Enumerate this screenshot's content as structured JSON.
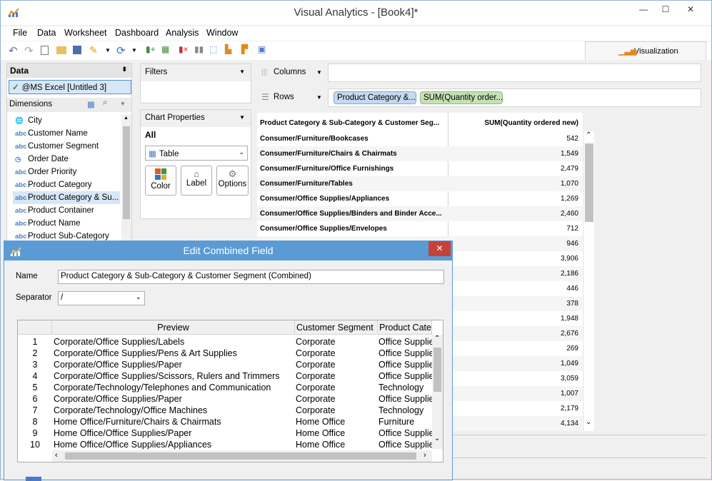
{
  "window": {
    "title": "Visual Analytics - [Book4]*",
    "min": "—",
    "max": "☐",
    "close": "✕"
  },
  "menu": [
    "File",
    "Data",
    "Worksheet",
    "Dashboard",
    "Analysis",
    "Window"
  ],
  "toolbar": {
    "viz_label": "Visualization"
  },
  "data_pane": {
    "header": "Data",
    "source": "@MS Excel [Untitled 3]",
    "dimensions_header": "Dimensions",
    "dimensions": [
      {
        "icon": "globe-icon",
        "type": "🌐",
        "label": "City"
      },
      {
        "icon": "abc-icon",
        "type": "abc",
        "label": "Customer Name"
      },
      {
        "icon": "abc-icon",
        "type": "abc",
        "label": "Customer Segment"
      },
      {
        "icon": "date-icon",
        "type": "◷",
        "label": "Order Date"
      },
      {
        "icon": "abc-icon",
        "type": "abc",
        "label": "Order Priority"
      },
      {
        "icon": "abc-icon",
        "type": "abc",
        "label": "Product Category"
      },
      {
        "icon": "abc-icon",
        "type": "abc",
        "label": "Product Category & Su..."
      },
      {
        "icon": "abc-icon",
        "type": "abc",
        "label": "Product Container"
      },
      {
        "icon": "abc-icon",
        "type": "abc",
        "label": "Product Name"
      },
      {
        "icon": "abc-icon",
        "type": "abc",
        "label": "Product Sub-Category"
      }
    ]
  },
  "filters": {
    "label": "Filters"
  },
  "chart_properties": {
    "label": "Chart Properties",
    "scope": "All",
    "chart_type": "Table",
    "buttons": [
      "Color",
      "Label",
      "Options"
    ]
  },
  "shelves": {
    "columns_label": "Columns",
    "rows_label": "Rows",
    "rows_pills": [
      "Product Category &...",
      "SUM(Quantity order..."
    ]
  },
  "table": {
    "col1_header": "Product Category & Sub-Category & Customer Seg...",
    "col2_header": "SUM(Quantity ordered new)",
    "rows": [
      {
        "name": "Consumer/Furniture/Bookcases",
        "value": "542"
      },
      {
        "name": "Consumer/Furniture/Chairs & Chairmats",
        "value": "1,549"
      },
      {
        "name": "Consumer/Furniture/Office Furnishings",
        "value": "2,479"
      },
      {
        "name": "Consumer/Furniture/Tables",
        "value": "1,070"
      },
      {
        "name": "Consumer/Office Supplies/Appliances",
        "value": "1,269"
      },
      {
        "name": "Consumer/Office Supplies/Binders and Binder Acce...",
        "value": "2,460"
      },
      {
        "name": "Consumer/Office Supplies/Envelopes",
        "value": "712"
      },
      {
        "name": "",
        "value": "946"
      },
      {
        "name": "",
        "value": "3,906"
      },
      {
        "name": "",
        "value": "2,186"
      },
      {
        "name": "",
        "value": "446"
      },
      {
        "name": "",
        "value": "378"
      },
      {
        "name": "",
        "value": "1,948"
      },
      {
        "name": "",
        "value": "2,676"
      },
      {
        "name": "",
        "value": "269"
      },
      {
        "name": "",
        "value": "1,049"
      },
      {
        "name": "",
        "value": "3,059"
      },
      {
        "name": "",
        "value": "1,007"
      },
      {
        "name": "",
        "value": "2,179"
      },
      {
        "name": "",
        "value": "4,134"
      }
    ]
  },
  "dialog": {
    "title": "Edit Combined Field",
    "close": "✕",
    "name_label": "Name",
    "name_value": "Product Category & Sub-Category & Customer Segment (Combined)",
    "separator_label": "Separator",
    "separator_value": "/",
    "grid_headers": [
      "Preview",
      "Customer Segment",
      "Product Cate"
    ],
    "grid_rows": [
      {
        "n": "1",
        "preview": "Corporate/Office Supplies/Labels",
        "seg": "Corporate",
        "cat": "Office Supplie"
      },
      {
        "n": "2",
        "preview": "Corporate/Office Supplies/Pens & Art Supplies",
        "seg": "Corporate",
        "cat": "Office Supplie"
      },
      {
        "n": "3",
        "preview": "Corporate/Office Supplies/Paper",
        "seg": "Corporate",
        "cat": "Office Supplie"
      },
      {
        "n": "4",
        "preview": "Corporate/Office Supplies/Scissors, Rulers and Trimmers",
        "seg": "Corporate",
        "cat": "Office Supplie"
      },
      {
        "n": "5",
        "preview": "Corporate/Technology/Telephones and Communication",
        "seg": "Corporate",
        "cat": "Technology"
      },
      {
        "n": "6",
        "preview": "Corporate/Office Supplies/Paper",
        "seg": "Corporate",
        "cat": "Office Supplie"
      },
      {
        "n": "7",
        "preview": "Corporate/Technology/Office Machines",
        "seg": "Corporate",
        "cat": "Technology"
      },
      {
        "n": "8",
        "preview": "Home Office/Furniture/Chairs & Chairmats",
        "seg": "Home Office",
        "cat": "Furniture"
      },
      {
        "n": "9",
        "preview": "Home Office/Office Supplies/Paper",
        "seg": "Home Office",
        "cat": "Office Supplie"
      },
      {
        "n": "10",
        "preview": "Home Office/Office Supplies/Appliances",
        "seg": "Home Office",
        "cat": "Office Supplie"
      }
    ]
  }
}
